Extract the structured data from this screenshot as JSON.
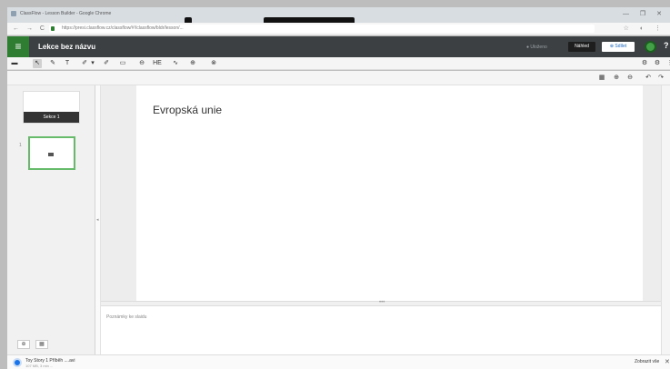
{
  "browser": {
    "window_title": "ClassFlow - Lesson Builder - Google Chrome",
    "url": "https://presi.classflow.cz/classflow/#!/classflow/bldr/lesson/...",
    "window_controls": "— ❐ ✕",
    "nav_icons": "← → C",
    "ext_icons": "☆ ◐ ⋮"
  },
  "app": {
    "menu_icon": "≡",
    "lesson_title": "Lekce bez názvu",
    "save_status": "● Uloženo",
    "preview_label": "Náhled",
    "share_label": "⊕ Sdílet",
    "help_label": "?"
  },
  "toolbar": {
    "left_tools": [
      "▬",
      "↖",
      "✎",
      "T",
      "✐",
      "▾",
      "✐",
      "▭",
      "⊖",
      "HE",
      "∿",
      "⊕",
      "⊗"
    ],
    "right_tools": [
      "⚙",
      "⚙",
      "⋮"
    ]
  },
  "subbar": {
    "tools": [
      "▦",
      "⊕",
      "⊖",
      "↶",
      "↷"
    ]
  },
  "sidebar": {
    "section_label": "Sekce 1",
    "slide_number": "1"
  },
  "slide": {
    "title": "Evropská unie"
  },
  "notes": {
    "placeholder": "Poznámky ke slaidu"
  },
  "footer": {
    "left_buttons": [
      "⊕",
      "▦"
    ],
    "splitter_dots": "•••"
  },
  "downloads": {
    "file_name": "Toy Story 1 Příběh ....avi",
    "file_sub": "107 MB, 3 min ...",
    "show_all": "Zobrazit vše",
    "close": "✕"
  }
}
